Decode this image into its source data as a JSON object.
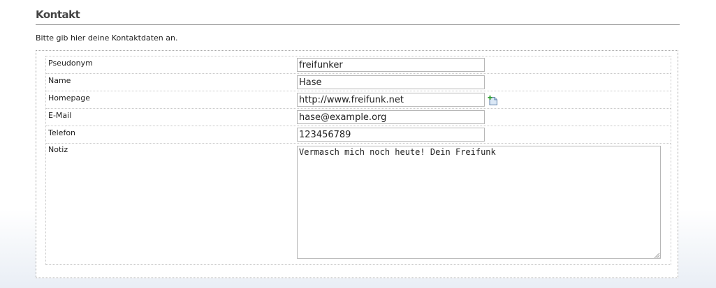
{
  "section": {
    "title": "Kontakt",
    "description": "Bitte gib hier deine Kontaktdaten an."
  },
  "fields": {
    "pseudonym": {
      "label": "Pseudonym",
      "value": "freifunker"
    },
    "name": {
      "label": "Name",
      "value": "Hase"
    },
    "homepage": {
      "label": "Homepage",
      "value": "http://www.freifunk.net",
      "add_icon": "add-entry-icon"
    },
    "email": {
      "label": "E-Mail",
      "value": "hase@example.org"
    },
    "phone": {
      "label": "Telefon",
      "value": "123456789"
    },
    "note": {
      "label": "Notiz",
      "value": "Vermasch mich noch heute! Dein Freifunk"
    }
  }
}
